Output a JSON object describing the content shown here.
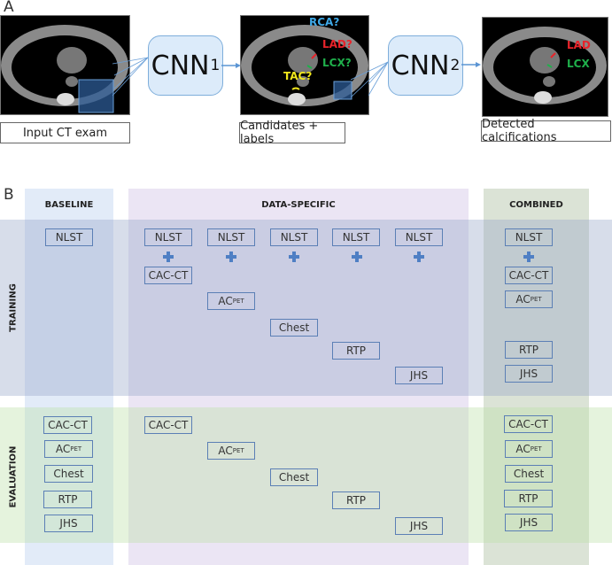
{
  "panel_a": {
    "letter": "A",
    "images": [
      {
        "caption": "Input CT exam",
        "labels": []
      },
      {
        "caption": "Candidates + labels",
        "labels": [
          {
            "text": "RCA?",
            "color": "#3fa9e8"
          },
          {
            "text": "LAD?",
            "color": "#e8232a"
          },
          {
            "text": "LCX?",
            "color": "#1fb04b"
          },
          {
            "text": "TAC?",
            "color": "#f0e61c"
          }
        ]
      },
      {
        "caption": "Detected calcifications",
        "labels": [
          {
            "text": "LAD",
            "color": "#e8232a"
          },
          {
            "text": "LCX",
            "color": "#1fb04b"
          }
        ]
      }
    ],
    "networks": [
      {
        "name": "CNN",
        "subscript": "1"
      },
      {
        "name": "CNN",
        "subscript": "2"
      }
    ]
  },
  "panel_b": {
    "letter": "B",
    "columns": [
      "BASELINE",
      "DATA-SPECIFIC",
      "COMBINED"
    ],
    "rows": [
      "TRAINING",
      "EVALUATION"
    ],
    "training": {
      "baseline": [
        "NLST"
      ],
      "data_specific": [
        {
          "base": "NLST",
          "plus": "CAC-CT"
        },
        {
          "base": "NLST",
          "plus": "AC",
          "plus_sub": "PET"
        },
        {
          "base": "NLST",
          "plus": "Chest"
        },
        {
          "base": "NLST",
          "plus": "RTP"
        },
        {
          "base": "NLST",
          "plus": "JHS"
        }
      ],
      "combined": [
        {
          "text": "NLST"
        },
        {
          "text": "CAC-CT"
        },
        {
          "text": "AC",
          "sub": "PET"
        },
        {
          "text": "RTP"
        },
        {
          "text": "JHS"
        }
      ]
    },
    "evaluation": {
      "baseline": [
        {
          "text": "CAC-CT"
        },
        {
          "text": "AC",
          "sub": "PET"
        },
        {
          "text": "Chest"
        },
        {
          "text": "RTP"
        },
        {
          "text": "JHS"
        }
      ],
      "data_specific": [
        {
          "text": "CAC-CT"
        },
        {
          "text": "AC",
          "sub": "PET"
        },
        {
          "text": "Chest"
        },
        {
          "text": "RTP"
        },
        {
          "text": "JHS"
        }
      ],
      "combined": [
        {
          "text": "CAC-CT"
        },
        {
          "text": "AC",
          "sub": "PET"
        },
        {
          "text": "Chest"
        },
        {
          "text": "RTP"
        },
        {
          "text": "JHS"
        }
      ]
    }
  },
  "colors": {
    "box_border": "#5b7fb5",
    "plus": "#4f7fc4",
    "cnn_fill": "#dcebfa",
    "cnn_border": "#7eaedb"
  }
}
